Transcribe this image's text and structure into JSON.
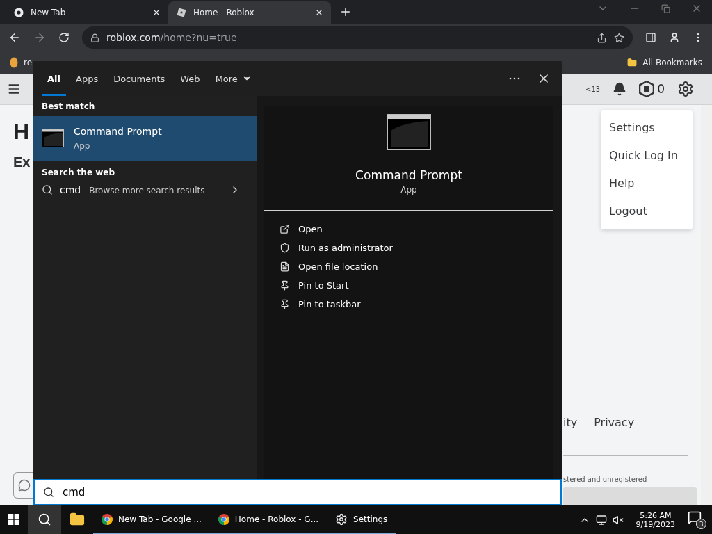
{
  "browser": {
    "tabs": [
      {
        "title": "New Tab",
        "kind": "chrome",
        "selected": false
      },
      {
        "title": "Home - Roblox",
        "kind": "roblox",
        "selected": true
      }
    ],
    "url": {
      "host": "roblox.com",
      "path": "/home?nu=true"
    },
    "bookmarks": [
      {
        "label": "re"
      }
    ],
    "all_bookmarks": "All Bookmarks"
  },
  "page": {
    "robux_age": "<13",
    "robux_count": "0",
    "heading": "H",
    "subheading": "Ex",
    "menu": [
      "Settings",
      "Quick Log In",
      "Help",
      "Logout"
    ],
    "footer_links": [
      "ity",
      "Privacy"
    ],
    "footer_note": "stered and unregistered"
  },
  "search": {
    "tabs": [
      {
        "label": "All",
        "selected": true
      },
      {
        "label": "Apps",
        "selected": false
      },
      {
        "label": "Documents",
        "selected": false
      },
      {
        "label": "Web",
        "selected": false
      },
      {
        "label": "More",
        "selected": false
      }
    ],
    "best_match_heading": "Best match",
    "best_match": {
      "name": "Command Prompt",
      "type": "App",
      "selected": true
    },
    "web_heading": "Search the web",
    "web_result": {
      "query": "cmd",
      "hint": " - Browse more search results"
    },
    "preview": {
      "name": "Command Prompt",
      "type": "App"
    },
    "actions": [
      {
        "label": "Open",
        "kind": "open"
      },
      {
        "label": "Run as administrator",
        "kind": "admin"
      },
      {
        "label": "Open file location",
        "kind": "file"
      },
      {
        "label": "Pin to Start",
        "kind": "pin"
      },
      {
        "label": "Pin to taskbar",
        "kind": "pin"
      }
    ],
    "query": "cmd"
  },
  "taskbar": {
    "search_active": true,
    "apps": [
      {
        "kind": "explorer",
        "running": false
      },
      {
        "label": "New Tab - Google ...",
        "kind": "chrome",
        "running": true
      },
      {
        "label": "Home - Roblox - G...",
        "kind": "chrome",
        "running": true
      },
      {
        "label": "Settings",
        "kind": "settings",
        "running": true
      }
    ],
    "time": "5:26 AM",
    "date": "9/19/2023",
    "notifications": "3"
  }
}
